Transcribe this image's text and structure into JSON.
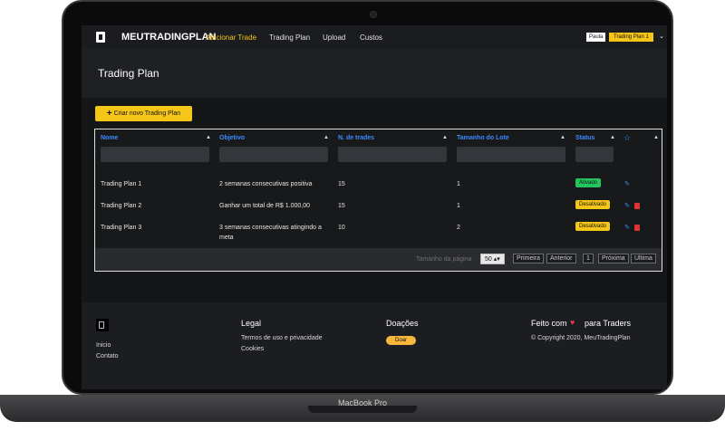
{
  "device": {
    "label": "MacBook Pro"
  },
  "nav": {
    "brand": "MEUTRADINGPLAN",
    "items": [
      {
        "label": "Adicionar Trade",
        "active": true
      },
      {
        "label": "Trading Plan",
        "active": false
      },
      {
        "label": "Upload",
        "active": false
      },
      {
        "label": "Custos",
        "active": false
      }
    ],
    "user": "Paula",
    "current_plan": "Trading Plan 1",
    "chevron_icon": "chevron-down-icon"
  },
  "page": {
    "title": "Trading Plan"
  },
  "create_button": {
    "label": "Criar novo Trading Plan",
    "icon": "plus-icon"
  },
  "table": {
    "columns": [
      "Nome",
      "Objetivo",
      "N. de trades",
      "Tamanho do Lote",
      "Status"
    ],
    "favorite_icon": "star-icon",
    "rows": [
      {
        "nome": "Trading Plan 1",
        "objetivo": "2 semanas consecutivas positiva",
        "trades": "15",
        "lote": "1",
        "status": "Ativado",
        "can_delete": false
      },
      {
        "nome": "Trading Plan 2",
        "objetivo": "Ganhar um total de R$ 1.000,00",
        "trades": "15",
        "lote": "1",
        "status": "Desativado",
        "can_delete": true
      },
      {
        "nome": "Trading Plan 3",
        "objetivo": "3 semanas consecutivas atingindo a meta",
        "trades": "10",
        "lote": "2",
        "status": "Desativado",
        "can_delete": true
      }
    ]
  },
  "pager": {
    "page_size_label": "Tamanho da página",
    "page_size": "50",
    "first": "Primeira",
    "previous": "Anterior",
    "current": "1",
    "next": "Próxima",
    "last": "Ultima"
  },
  "footer": {
    "links": [
      "Inicio",
      "Contato"
    ],
    "legal_title": "Legal",
    "legal_links": [
      "Termos de uso e privacidade",
      "Cookies"
    ],
    "donations_title": "Doações",
    "donate_button": "Doar",
    "made_with_prefix": "Feito com",
    "made_with_suffix": "para Traders",
    "copyright": "© Copyright 2020, MeuTradingPlan"
  },
  "colors": {
    "accent": "#f5c518",
    "link_blue": "#3b8bff",
    "active_green": "#22c55e",
    "danger": "#e03434"
  }
}
